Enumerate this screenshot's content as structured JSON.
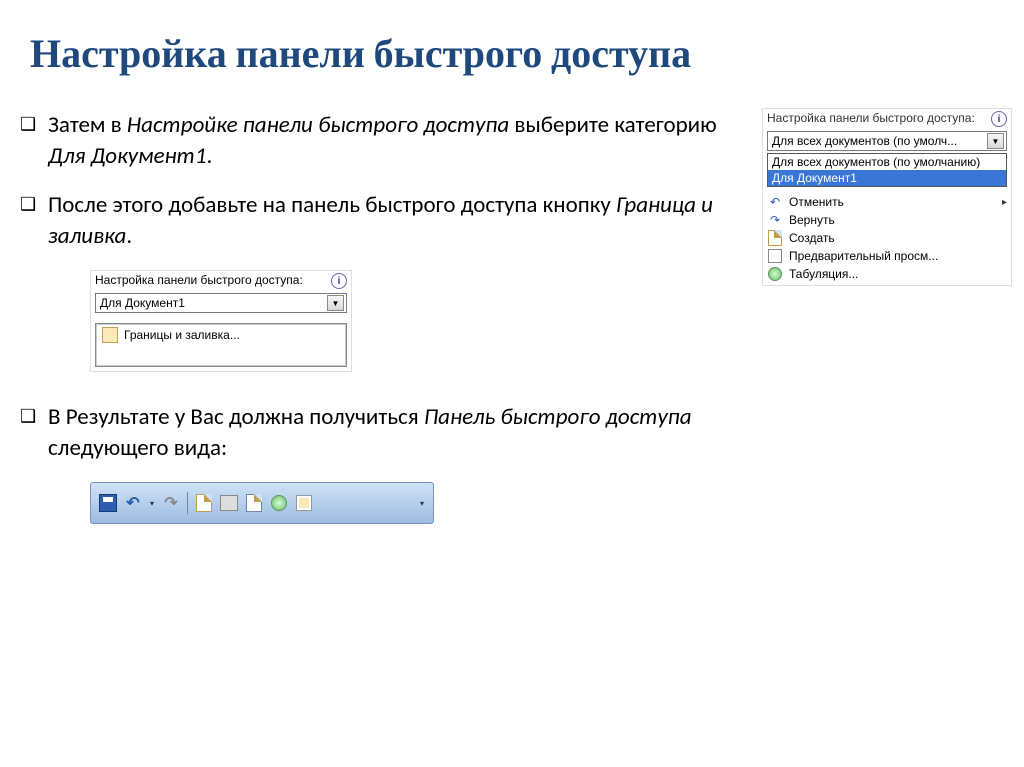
{
  "title": "Настройка панели быстрого доступа",
  "bullets": {
    "b1_pre": "Затем в ",
    "b1_i1": "Настройке панели быстрого доступа",
    "b1_mid": " выберите категорию ",
    "b1_i2": "Для Документ1",
    "b1_end": ".",
    "b2_pre": "После этого добавьте на панель быстрого доступа кнопку ",
    "b2_i1": "Граница и заливка",
    "b2_end": ".",
    "b3_pre": "В Результате у Вас должна получиться ",
    "b3_i1": "Панель быстрого доступа",
    "b3_end": " следующего вида:"
  },
  "panel_right": {
    "header": "Настройка панели быстрого доступа:",
    "combo_value": "Для всех документов (по умолч...",
    "options": [
      "Для всех документов (по умолчанию)",
      "Для Документ1"
    ],
    "commands": [
      {
        "icon": "↶",
        "label": "Отменить",
        "submenu": true
      },
      {
        "icon": "↷",
        "label": "Вернуть",
        "submenu": false
      },
      {
        "icon": "□",
        "label": "Создать",
        "submenu": false
      },
      {
        "icon": "⎙",
        "label": "Предварительный просм...",
        "submenu": false
      },
      {
        "icon": "●",
        "label": "Табуляция...",
        "submenu": false
      }
    ]
  },
  "panel_mid": {
    "header": "Настройка панели быстрого доступа:",
    "combo_value": "Для Документ1",
    "list_item": "Границы и заливка..."
  },
  "qat": {
    "items": [
      "save",
      "undo",
      "redo",
      "new",
      "print",
      "preview",
      "tab",
      "border"
    ]
  }
}
